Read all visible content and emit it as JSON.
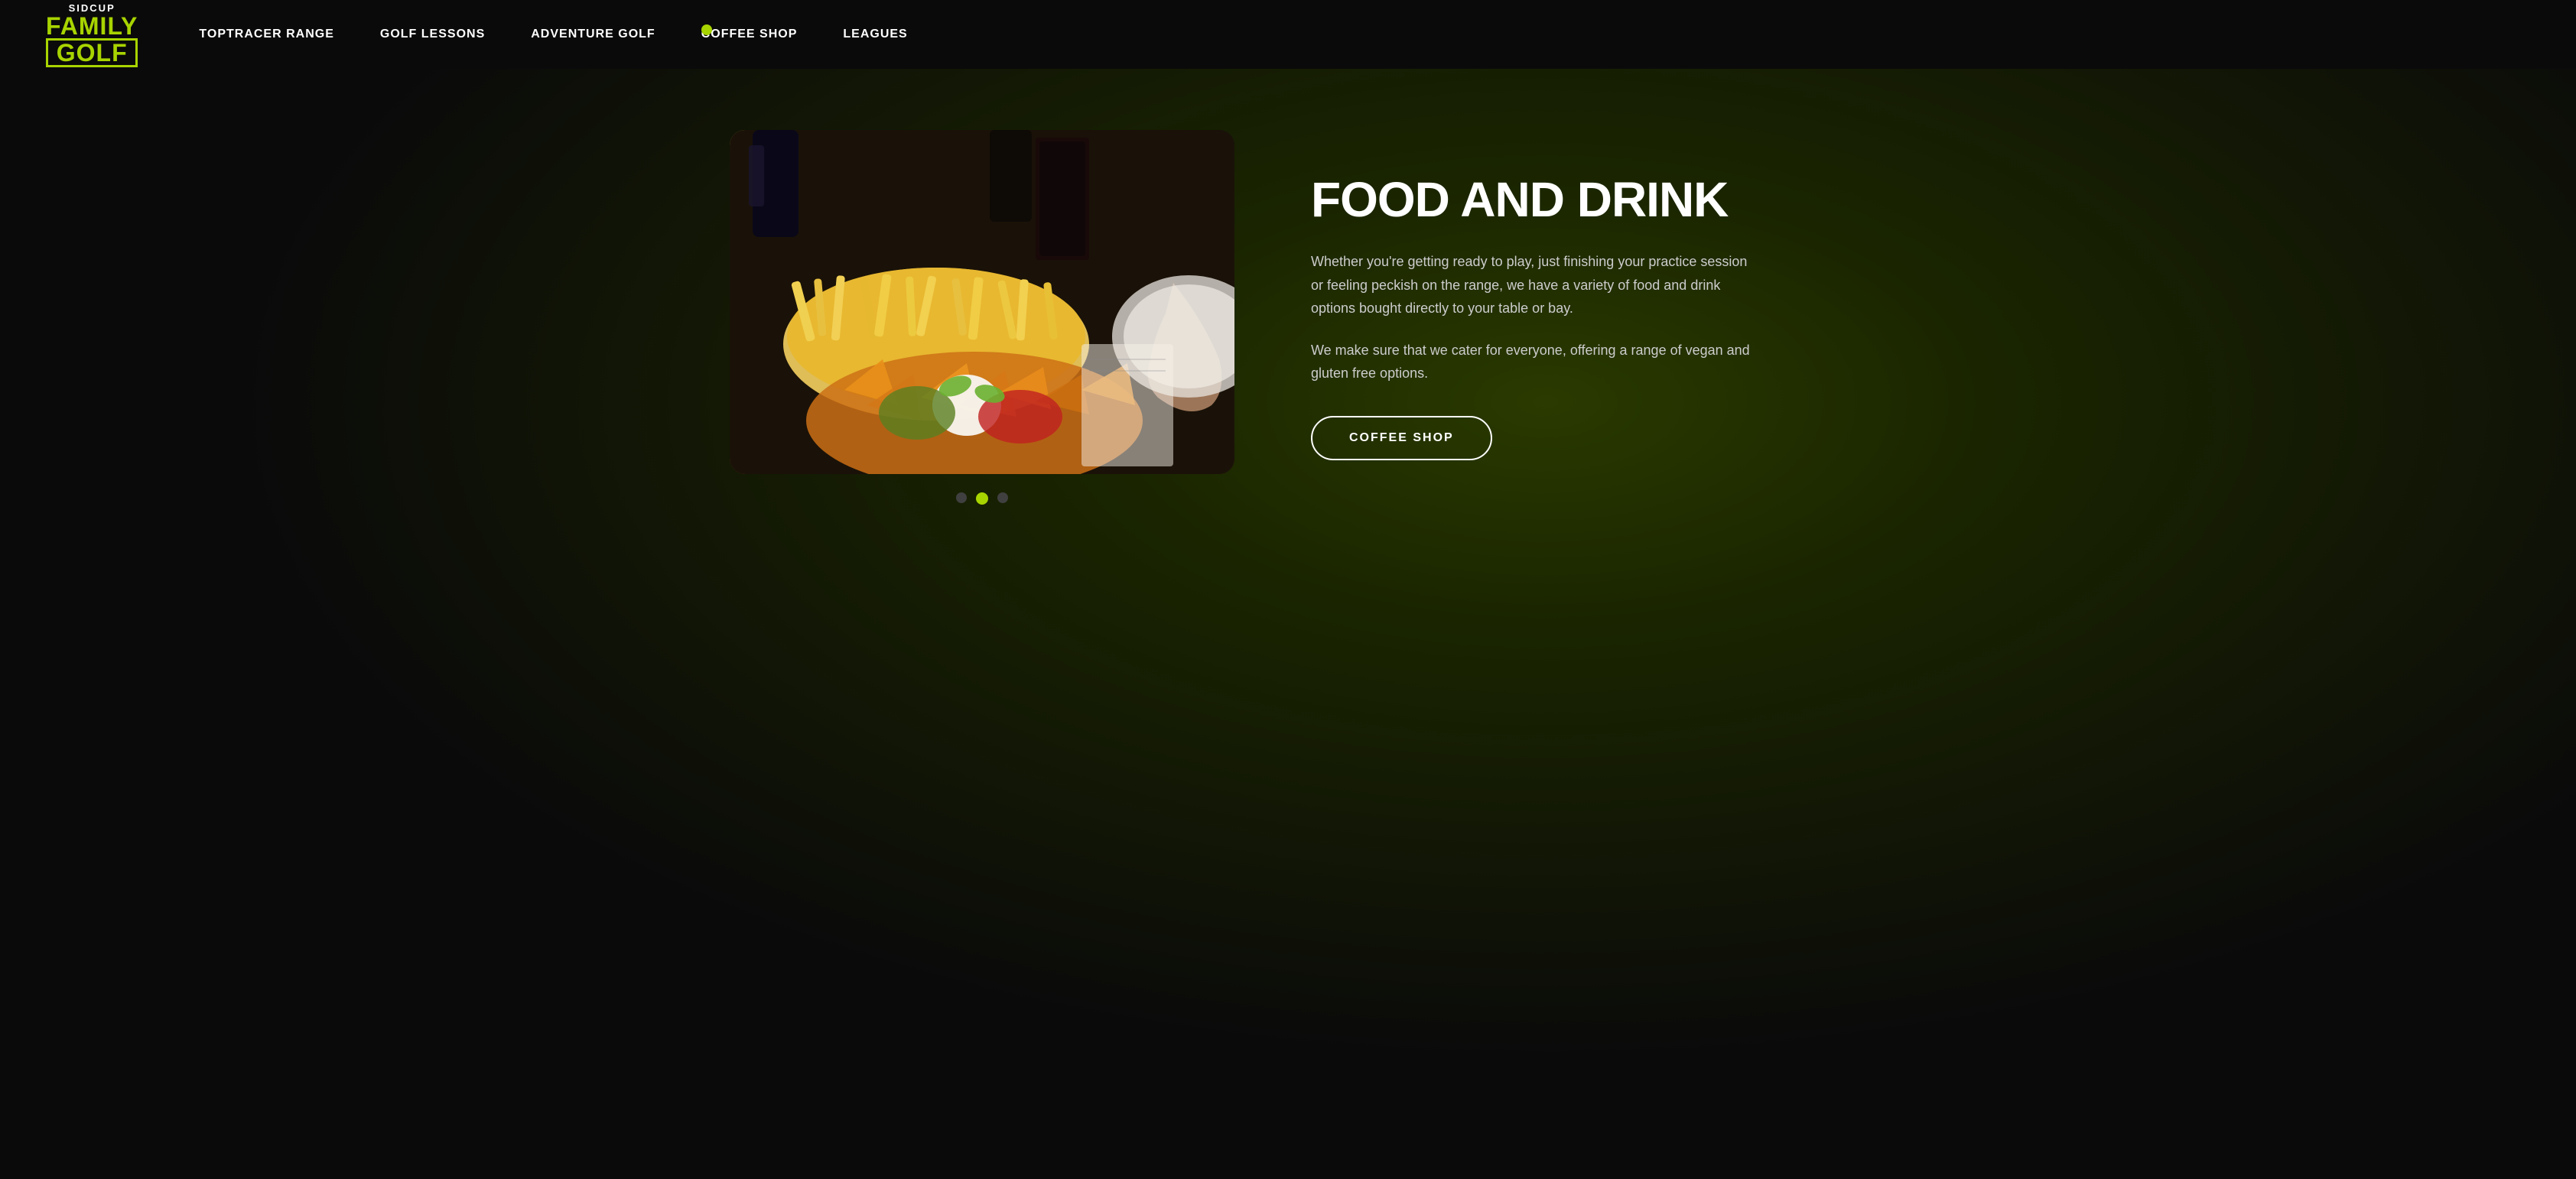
{
  "site": {
    "logo": {
      "sidcup": "SIDCUP",
      "family": "FAMILY",
      "golf": "GOLF"
    }
  },
  "nav": {
    "items": [
      {
        "id": "toptracer",
        "label": "TOPTRACER RANGE",
        "active": false
      },
      {
        "id": "golf-lessons",
        "label": "GOLF LESSONS",
        "active": false
      },
      {
        "id": "adventure-golf",
        "label": "ADVENTURE GOLF",
        "active": false
      },
      {
        "id": "coffee-shop",
        "label": "COFFEE SHOP",
        "active": true
      },
      {
        "id": "leagues",
        "label": "LEAGUES",
        "active": false
      }
    ]
  },
  "main": {
    "section_title": "FOOD AND DRINK",
    "description_1": "Whether you're getting ready to play, just finishing your practice session or feeling peckish on the range, we have a variety of food and drink options bought directly to your table or bay.",
    "description_2": "We make sure that we cater for everyone, offering a range of vegan and gluten free options.",
    "cta_button": "COFFEE SHOP"
  },
  "carousel": {
    "dots": [
      {
        "id": 1,
        "active": false
      },
      {
        "id": 2,
        "active": true
      },
      {
        "id": 3,
        "active": false
      }
    ]
  }
}
